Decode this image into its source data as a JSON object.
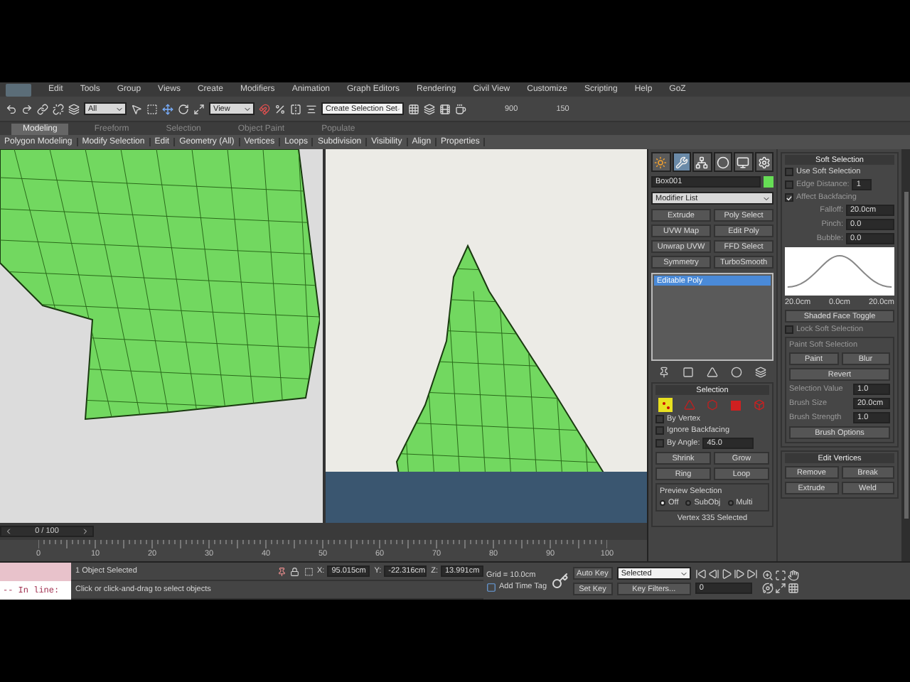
{
  "menu": [
    "Edit",
    "Tools",
    "Group",
    "Views",
    "Create",
    "Modifiers",
    "Animation",
    "Graph Editors",
    "Rendering",
    "Civil View",
    "Customize",
    "Scripting",
    "Help",
    "GoZ"
  ],
  "toolbar": {
    "selection_filter": "All",
    "coord_system": "View",
    "named_selection": "Create Selection Set",
    "readings": [
      "900",
      "150"
    ]
  },
  "ribbon_tabs": [
    {
      "label": "Modeling",
      "selected": true
    },
    {
      "label": "Freeform",
      "selected": false
    },
    {
      "label": "Selection",
      "selected": false
    },
    {
      "label": "Object Paint",
      "selected": false
    },
    {
      "label": "Populate",
      "selected": false
    }
  ],
  "ribbon_panels": [
    "Polygon Modeling",
    "Modify Selection",
    "Edit",
    "Geometry (All)",
    "Vertices",
    "Loops",
    "Subdivision",
    "Visibility",
    "Align",
    "Properties"
  ],
  "command_panel": {
    "tabs": [
      {
        "kind": "create",
        "selected": false
      },
      {
        "kind": "modify",
        "selected": true
      },
      {
        "kind": "hierarchy",
        "selected": false
      },
      {
        "kind": "motion",
        "selected": false
      },
      {
        "kind": "display",
        "selected": false
      },
      {
        "kind": "utilities",
        "selected": false
      }
    ],
    "object_name": "Box001",
    "modifier_list": "Modifier List",
    "modifier_buttons": [
      "Extrude",
      "Poly Select",
      "UVW Map",
      "Edit Poly",
      "Unwrap UVW",
      "FFD Select",
      "Symmetry",
      "TurboSmooth"
    ],
    "stack": [
      {
        "label": "Editable Poly",
        "selected": true
      }
    ],
    "selection": {
      "title": "Selection",
      "levels": [
        {
          "kind": "vertex",
          "selected": true
        },
        {
          "kind": "edge",
          "selected": false
        },
        {
          "kind": "border",
          "selected": false
        },
        {
          "kind": "polygon",
          "selected": false
        },
        {
          "kind": "element",
          "selected": false
        }
      ],
      "checks": [
        {
          "label": "By Vertex",
          "checked": false
        },
        {
          "label": "Ignore Backfacing",
          "checked": false
        }
      ],
      "by_angle": {
        "label": "By Angle:",
        "checked": false,
        "value": "45.0"
      },
      "buttons": [
        "Shrink",
        "Grow"
      ],
      "spinner_buttons": [
        "Ring",
        "Loop"
      ],
      "preview": {
        "title": "Preview Selection",
        "options": [
          {
            "label": "Off",
            "selected": true
          },
          {
            "label": "SubObj",
            "selected": false
          },
          {
            "label": "Multi",
            "selected": false
          }
        ]
      },
      "status": "Vertex 335 Selected"
    },
    "soft_selection": {
      "title": "Soft Selection",
      "use": {
        "label": "Use Soft Selection",
        "checked": false
      },
      "edge_distance": {
        "label": "Edge Distance:",
        "checked": false,
        "value": "1"
      },
      "affect_backfacing": {
        "label": "Affect Backfacing",
        "checked": true
      },
      "params": [
        {
          "label": "Falloff:",
          "value": "20.0cm"
        },
        {
          "label": "Pinch:",
          "value": "0.0"
        },
        {
          "label": "Bubble:",
          "value": "0.0"
        }
      ],
      "curve_labels": [
        "20.0cm",
        "0.0cm",
        "20.0cm"
      ],
      "toggle_button": "Shaded Face Toggle",
      "lock": {
        "label": "Lock Soft Selection",
        "checked": false
      },
      "paint": {
        "title": "Paint Soft Selection",
        "buttons": [
          "Paint",
          "Blur"
        ],
        "revert": "Revert",
        "params": [
          {
            "label": "Selection Value",
            "value": "1.0"
          },
          {
            "label": "Brush Size",
            "value": "20.0cm"
          },
          {
            "label": "Brush Strength",
            "value": "1.0"
          }
        ],
        "options": "Brush Options"
      }
    },
    "edit_vertices": {
      "title": "Edit Vertices",
      "buttons": [
        "Remove",
        "Break"
      ],
      "settings_buttons": [
        "Extrude",
        "Weld"
      ]
    }
  },
  "timeline": {
    "frame": "0 / 100",
    "level": 0,
    "ticks": [
      "0",
      "10",
      "20",
      "30",
      "40",
      "50",
      "60",
      "70",
      "80",
      "90",
      "100"
    ]
  },
  "status_bar": {
    "listener": "-- In line:",
    "selected": "1 Object Selected",
    "prompt": "Click or click-and-drag to select objects",
    "coords": [
      {
        "axis": "X:",
        "value": "95.015cm"
      },
      {
        "axis": "Y:",
        "value": "-22.316cm"
      },
      {
        "axis": "Z:",
        "value": "13.991cm"
      }
    ],
    "grid": "Grid = 10.0cm",
    "time_tag": "Add Time Tag",
    "auto_key": "Auto Key",
    "key_mode": "Selected",
    "set_key": "Set Key",
    "key_filters": "Key Filters...",
    "current_frame": "0"
  }
}
